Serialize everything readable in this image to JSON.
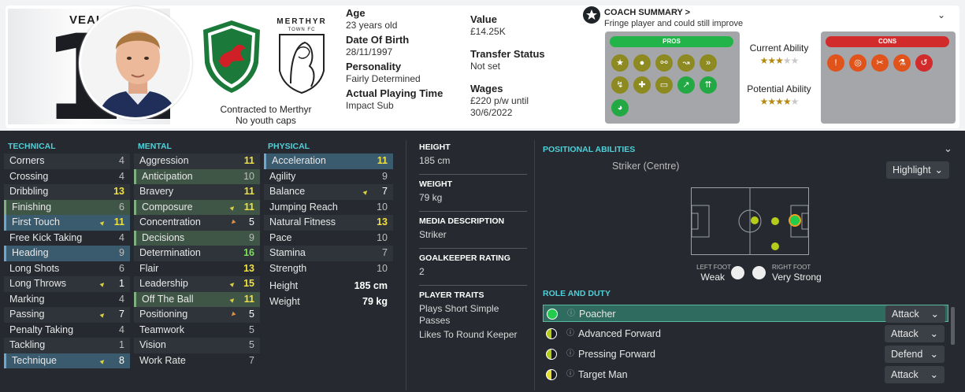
{
  "player": {
    "shirt_name": "VEAL",
    "shirt_number": "12",
    "contract": "Contracted to Merthyr",
    "caps": "No youth caps",
    "club_top": "MERTHYR",
    "club_bottom": "TOWN FC"
  },
  "details": {
    "age_label": "Age",
    "age": "23 years old",
    "dob_label": "Date Of Birth",
    "dob": "28/11/1997",
    "personality_label": "Personality",
    "personality": "Fairly Determined",
    "apt_label": "Actual Playing Time",
    "apt": "Impact Sub",
    "value_label": "Value",
    "value": "£14.25K",
    "ts_label": "Transfer Status",
    "ts": "Not set",
    "wages_label": "Wages",
    "wages": "£220 p/w until",
    "wages_until": "30/6/2022"
  },
  "coach": {
    "title": "COACH SUMMARY >",
    "subtitle": "Fringe player and could still improve",
    "pros": "PROS",
    "cons": "CONS",
    "ca_label": "Current Ability",
    "ca_stars": 3,
    "pa_label": "Potential Ability",
    "pa_stars": 4
  },
  "technical": {
    "header": "TECHNICAL",
    "rows": [
      [
        "Corners",
        "4"
      ],
      [
        "Crossing",
        "4"
      ],
      [
        "Dribbling",
        "13"
      ],
      [
        "Finishing",
        "6"
      ],
      [
        "First Touch",
        "11"
      ],
      [
        "Free Kick Taking",
        "4"
      ],
      [
        "Heading",
        "9"
      ],
      [
        "Long Shots",
        "6"
      ],
      [
        "Long Throws",
        "1"
      ],
      [
        "Marking",
        "4"
      ],
      [
        "Passing",
        "7"
      ],
      [
        "Penalty Taking",
        "4"
      ],
      [
        "Tackling",
        "1"
      ],
      [
        "Technique",
        "8"
      ]
    ]
  },
  "mental": {
    "header": "MENTAL",
    "rows": [
      [
        "Aggression",
        "11"
      ],
      [
        "Anticipation",
        "10"
      ],
      [
        "Bravery",
        "11"
      ],
      [
        "Composure",
        "11"
      ],
      [
        "Concentration",
        "5"
      ],
      [
        "Decisions",
        "9"
      ],
      [
        "Determination",
        "16"
      ],
      [
        "Flair",
        "13"
      ],
      [
        "Leadership",
        "15"
      ],
      [
        "Off The Ball",
        "11"
      ],
      [
        "Positioning",
        "5"
      ],
      [
        "Teamwork",
        "5"
      ],
      [
        "Vision",
        "5"
      ],
      [
        "Work Rate",
        "7"
      ]
    ]
  },
  "physical": {
    "header": "PHYSICAL",
    "rows": [
      [
        "Acceleration",
        "11"
      ],
      [
        "Agility",
        "9"
      ],
      [
        "Balance",
        "7"
      ],
      [
        "Jumping Reach",
        "10"
      ],
      [
        "Natural Fitness",
        "13"
      ],
      [
        "Pace",
        "10"
      ],
      [
        "Stamina",
        "7"
      ],
      [
        "Strength",
        "10"
      ]
    ],
    "height_label": "Height",
    "height": "185 cm",
    "weight_label": "Weight",
    "weight": "79 kg"
  },
  "info": {
    "h_label": "HEIGHT",
    "h": "185 cm",
    "w_label": "WEIGHT",
    "w": "79 kg",
    "md_label": "MEDIA DESCRIPTION",
    "md": "Striker",
    "gk_label": "GOALKEEPER RATING",
    "gk": "2",
    "traits_label": "PLAYER TRAITS",
    "trait1": "Plays Short Simple Passes",
    "trait2": "Likes To Round Keeper"
  },
  "positions": {
    "title": "POSITIONAL ABILITIES",
    "pos_name": "Striker (Centre)",
    "highlight": "Highlight",
    "left_foot_label": "LEFT FOOT",
    "left_foot": "Weak",
    "right_foot_label": "RIGHT FOOT",
    "right_foot": "Very Strong"
  },
  "roles": {
    "title": "ROLE AND DUTY",
    "items": [
      [
        "Poacher",
        "Attack"
      ],
      [
        "Advanced Forward",
        "Attack"
      ],
      [
        "Pressing Forward",
        "Defend"
      ],
      [
        "Target Man",
        "Attack"
      ]
    ]
  }
}
